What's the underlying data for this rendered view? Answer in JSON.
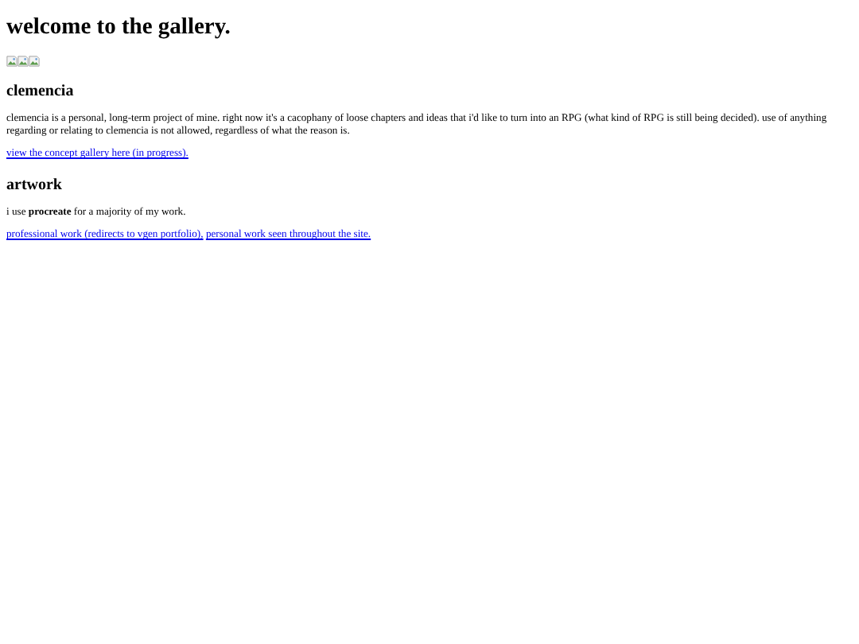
{
  "title": "welcome to the gallery.",
  "images": [
    {
      "kind": "broken_image"
    },
    {
      "kind": "broken_image"
    },
    {
      "kind": "broken_image"
    }
  ],
  "sections": [
    {
      "heading": "clemencia",
      "paragraphs": [
        {
          "text": "clemencia is a personal, long-term project of mine. right now it's a cacophany of loose chapters and ideas that i'd like to turn into an RPG (what kind of RPG is still being decided). use of anything regarding or relating to clemencia is not allowed, regardless of what the reason is."
        }
      ],
      "links": [
        {
          "text": "view the concept gallery here (in progress)."
        }
      ]
    },
    {
      "heading": "artwork",
      "paragraphs": [
        {
          "text": "i use **procreate** for a majority of my work."
        }
      ],
      "links": [
        {
          "text": "professional work (redirects to vgen portfolio),"
        },
        {
          "text": "personal work seen throughout the site."
        }
      ]
    }
  ]
}
